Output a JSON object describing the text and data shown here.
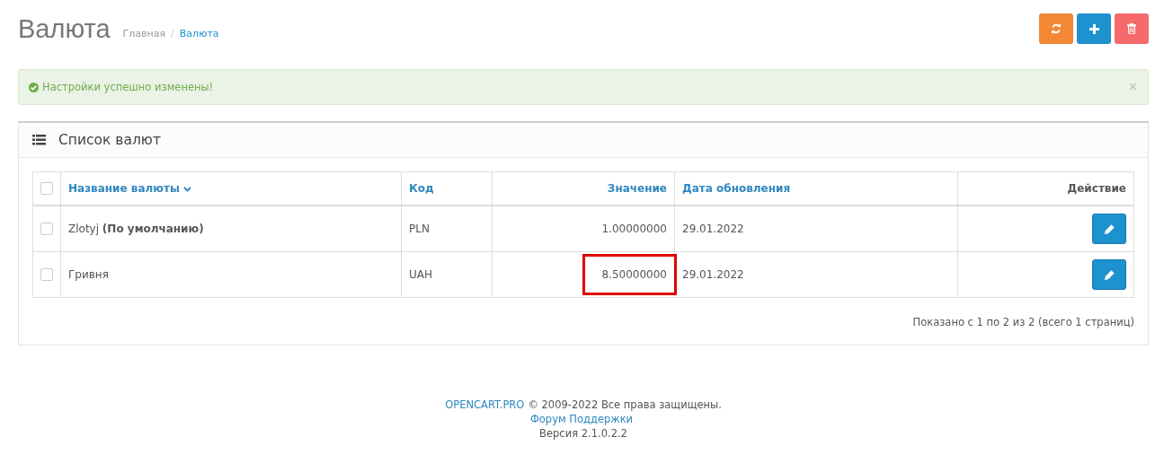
{
  "page": {
    "title": "Валюта",
    "separator": "/",
    "breadcrumbs": [
      {
        "label": "Главная",
        "current": false
      },
      {
        "label": "Валюта",
        "current": true
      }
    ]
  },
  "toolbar": [
    {
      "kind": "refresh"
    },
    {
      "kind": "add"
    },
    {
      "kind": "delete"
    }
  ],
  "alert": {
    "text": "Настройки успешно изменены!",
    "close": "×"
  },
  "panel": {
    "title": "Список валют"
  },
  "table": {
    "select_all": {
      "checked": false
    },
    "columns": [
      {
        "label": "Название валюты",
        "sorted": true,
        "link": true
      },
      {
        "label": "Код",
        "sorted": false,
        "link": true
      },
      {
        "label": "Значение",
        "sorted": false,
        "link": true
      },
      {
        "label": "Дата обновления",
        "sorted": false,
        "link": true
      },
      {
        "label": "Действие",
        "sorted": false,
        "link": false
      }
    ],
    "rows": [
      {
        "checked": false,
        "name": "Zlotyj **(По умолчанию)**",
        "code": "PLN",
        "value": "1.00000000",
        "highlighted": false,
        "date": "29.01.2022"
      },
      {
        "checked": false,
        "name": "Гривня",
        "code": "UAH",
        "value": "8.50000000",
        "highlighted": true,
        "date": "29.01.2022"
      }
    ]
  },
  "pagination": {
    "text": "Показано с 1 по 2 из 2 (всего 1 страниц)"
  },
  "footer": {
    "brand": "OPENCART.PRO",
    "copyright": "© 2009-2022 Все права защищены.",
    "forum": "Форум Поддержки",
    "version": "Версия 2.1.0.2.2"
  }
}
